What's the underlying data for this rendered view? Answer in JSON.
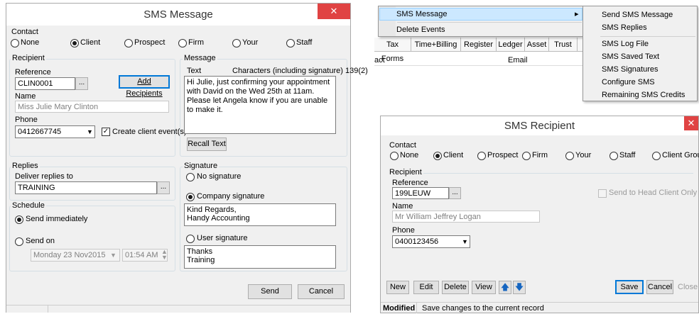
{
  "sms_message": {
    "title": "SMS Message",
    "close": "✕",
    "contact": {
      "label": "Contact",
      "options": [
        "None",
        "Client",
        "Prospect",
        "Firm",
        "Your",
        "Staff"
      ],
      "selected": "Client"
    },
    "recipient": {
      "label": "Recipient",
      "reference_label": "Reference",
      "reference_value": "CLIN0001",
      "ellipsis": "...",
      "add_recipients": "Add Recipients",
      "name_label": "Name",
      "name_value": "Miss Julie Mary Clinton",
      "phone_label": "Phone",
      "phone_value": "0412667745",
      "create_event_label": "Create client event(s)",
      "create_event_checked": true
    },
    "message": {
      "label": "Message",
      "text_label": "Text",
      "chars_label": "Characters (including signature)  139(2)",
      "text": "Hi Julie, just confirming your appointment with David on the Wed 25th at 11am.  Please let Angela know if you are unable to make it.",
      "recall": "Recall Text"
    },
    "replies": {
      "label": "Replies",
      "deliver_label": "Deliver replies to",
      "deliver_value": "TRAINING",
      "ellipsis": "..."
    },
    "schedule": {
      "label": "Schedule",
      "immediately": "Send immediately",
      "send_on": "Send on",
      "date": "Monday   23 Nov2015",
      "time": "01:54 AM"
    },
    "signature": {
      "label": "Signature",
      "none": "No signature",
      "company": "Company signature",
      "company_text": "Kind Regards,\nHandy Accounting",
      "user": "User signature",
      "user_text": "Thanks\nTraining"
    },
    "send": "Send",
    "cancel": "Cancel"
  },
  "context_menu": {
    "items": [
      "SMS Message",
      "Delete Events"
    ],
    "submenu_arrow": "▸",
    "submenu": [
      "Send SMS Message",
      "SMS Replies",
      "SMS Log File",
      "SMS Saved Text",
      "SMS Signatures",
      "Configure SMS",
      "Remaining SMS Credits"
    ],
    "tabs": [
      "Tax Forms",
      "Time+Billing",
      "Register",
      "Ledger",
      "Asset",
      "Trust"
    ],
    "col_left": "act",
    "col_email": "Email"
  },
  "sms_recipient": {
    "title": "SMS Recipient",
    "close": "✕",
    "contact": {
      "label": "Contact",
      "options": [
        "None",
        "Client",
        "Prospect",
        "Firm",
        "Your",
        "Staff",
        "Client Group"
      ],
      "selected": "Client"
    },
    "recipient": {
      "label": "Recipient",
      "reference_label": "Reference",
      "reference_value": "199LEUW",
      "ellipsis": "...",
      "head_client": "Send to Head Client Only",
      "name_label": "Name",
      "name_value": "Mr William Jeffrey Logan",
      "phone_label": "Phone",
      "phone_value": "0400123456"
    },
    "buttons": {
      "new": "New",
      "edit": "Edit",
      "delete": "Delete",
      "view": "View",
      "save": "Save",
      "cancel": "Cancel",
      "close": "Close"
    },
    "status_mode": "Modified",
    "status_text": "Save changes to the current record"
  },
  "colors": {
    "close_red": "#e04343",
    "arrow_blue": "#1565c0",
    "menu_highlight": "#cce8ff"
  }
}
